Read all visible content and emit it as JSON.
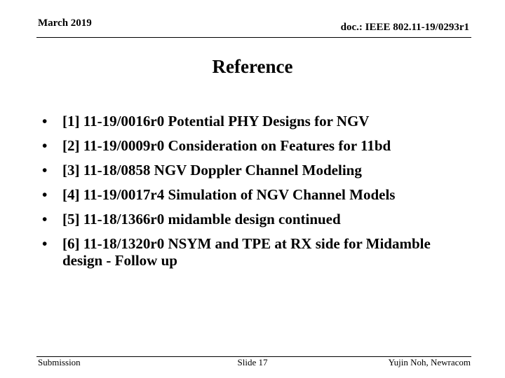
{
  "header": {
    "date": "March 2019",
    "doc_id": "doc.: IEEE 802.11-19/0293r1"
  },
  "title": "Reference",
  "references": [
    {
      "bullet": "•",
      "text": "[1] 11-19/0016r0 Potential PHY Designs for NGV"
    },
    {
      "bullet": "•",
      "text": "[2] 11-19/0009r0 Consideration on Features for 11bd"
    },
    {
      "bullet": "•",
      "text": "[3] 11-18/0858 NGV Doppler Channel Modeling"
    },
    {
      "bullet": "•",
      "text": "[4] 11-19/0017r4 Simulation of NGV Channel Models"
    },
    {
      "bullet": "•",
      "text": "[5] 11-18/1366r0 midamble design continued"
    },
    {
      "bullet": "•",
      "text": "[6] 11-18/1320r0 NSYM and TPE at RX side for Midamble design - Follow up"
    }
  ],
  "footer": {
    "left": "Submission",
    "center": "Slide 17",
    "right": "Yujin Noh, Newracom"
  }
}
